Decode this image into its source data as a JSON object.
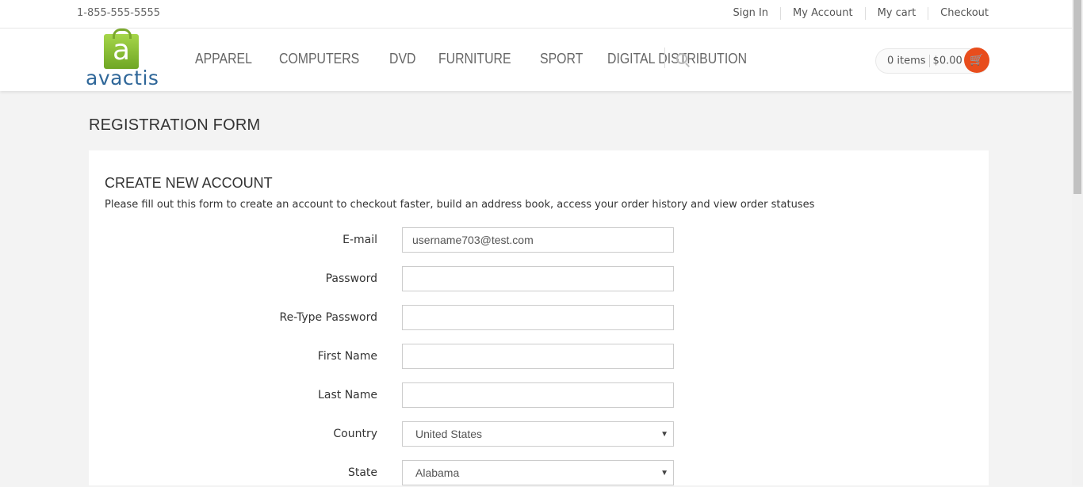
{
  "topbar": {
    "phone": "1-855-555-5555",
    "links": [
      "Sign In",
      "My Account",
      "My cart",
      "Checkout"
    ]
  },
  "header": {
    "logo_letter": "a",
    "brand": "avactis",
    "nav": [
      "APPAREL",
      "COMPUTERS",
      "DVD",
      "FURNITURE",
      "SPORT",
      "DIGITAL DISTRIBUTION"
    ],
    "cart_items": "0 items",
    "cart_total": "$0.00"
  },
  "page": {
    "title": "REGISTRATION FORM"
  },
  "form": {
    "title": "CREATE NEW ACCOUNT",
    "description": "Please fill out this form to create an account to checkout faster, build an address book, access your order history and view order statuses",
    "email_label": "E-mail",
    "email_value": "username703@test.com",
    "password_label": "Password",
    "retype_label": "Re-Type Password",
    "first_name_label": "First Name",
    "last_name_label": "Last Name",
    "country_label": "Country",
    "country_value": "United States",
    "state_label": "State",
    "state_value": "Alabama"
  },
  "colors": {
    "brand_blue": "#2f6799",
    "logo_green": "#8cc43a",
    "cart_orange": "#e84d1c"
  }
}
